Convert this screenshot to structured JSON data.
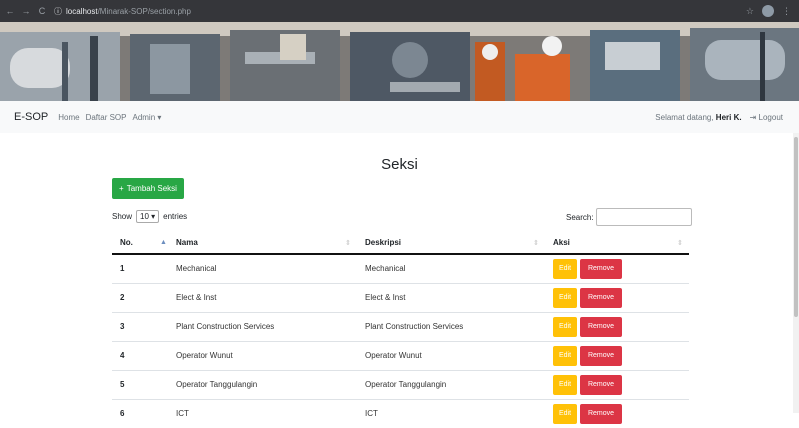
{
  "browser": {
    "back": "←",
    "forward": "→",
    "reload": "C",
    "info": "ⓘ",
    "url_host": "localhost",
    "url_path": "/Minarak-SOP/section.php",
    "star": "☆",
    "menu": "⋮"
  },
  "navbar": {
    "brand": "E-SOP",
    "links": [
      "Home",
      "Daftar SOP",
      "Admin ▾"
    ],
    "welcome": "Selamat datang,",
    "user": "Heri K.",
    "logout_icon": "⇥",
    "logout": "Logout"
  },
  "page": {
    "title": "Seksi",
    "add_button": "Tambah Seksi",
    "add_icon": "+",
    "show": "Show",
    "entries_value": "10 ▾",
    "entries": "entries",
    "search_label": "Search:"
  },
  "table": {
    "headers": [
      "No.",
      "Nama",
      "Deskripsi",
      "Aksi"
    ],
    "rows": [
      {
        "no": "1",
        "nama": "Mechanical",
        "deskripsi": "Mechanical"
      },
      {
        "no": "2",
        "nama": "Elect & Inst",
        "deskripsi": "Elect & Inst"
      },
      {
        "no": "3",
        "nama": "Plant Construction Services",
        "deskripsi": "Plant Construction Services"
      },
      {
        "no": "4",
        "nama": "Operator Wunut",
        "deskripsi": "Operator Wunut"
      },
      {
        "no": "5",
        "nama": "Operator Tanggulangin",
        "deskripsi": "Operator Tanggulangin"
      },
      {
        "no": "6",
        "nama": "ICT",
        "deskripsi": "ICT"
      }
    ],
    "edit_label": "Edit",
    "remove_label": "Remove"
  },
  "colors": {
    "add_button": "#28a745",
    "edit_button": "#ffc107",
    "remove_button": "#dc3545",
    "navbar_bg": "#f8f9fa",
    "browser_bg": "#35363a"
  }
}
